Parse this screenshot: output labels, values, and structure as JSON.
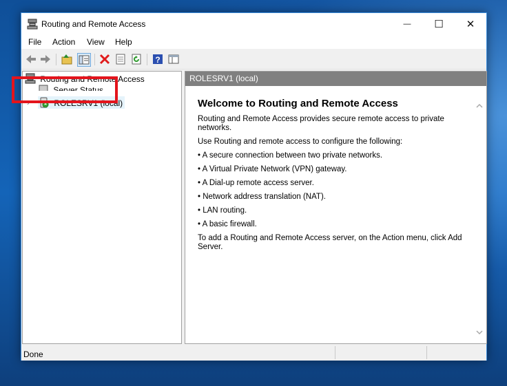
{
  "window": {
    "title": "Routing and Remote Access",
    "buttons": {
      "minimize": "—",
      "maximize": "☐",
      "close": "✕"
    }
  },
  "menu": [
    "File",
    "Action",
    "View",
    "Help"
  ],
  "toolbar": {
    "icons": [
      "back-icon",
      "forward-icon",
      "up-folder-icon",
      "show-hide-tree-icon",
      "delete-icon",
      "properties-icon",
      "refresh-icon",
      "help-icon",
      "console-icon"
    ]
  },
  "tree": {
    "root": "Routing and Remote Access",
    "server_status": "Server Status",
    "server": "ROLESRV1 (local)"
  },
  "detail": {
    "header": "ROLESRV1 (local)",
    "heading": "Welcome to Routing and Remote Access",
    "intro": "Routing and Remote Access provides secure remote access to private networks.",
    "use_text": "Use Routing and remote access to configure the following:",
    "bullets": [
      "A secure connection between two private networks.",
      "A Virtual Private Network (VPN) gateway.",
      "A Dial-up remote access server.",
      "Network address translation (NAT).",
      "LAN routing.",
      "A basic firewall."
    ],
    "footer": "To add a Routing and Remote Access server, on the Action menu, click Add Server."
  },
  "status": {
    "text": "Done"
  },
  "colors": {
    "highlight": "#e3141c",
    "header_bg": "#808080",
    "window_border": "#3c8ddc"
  }
}
